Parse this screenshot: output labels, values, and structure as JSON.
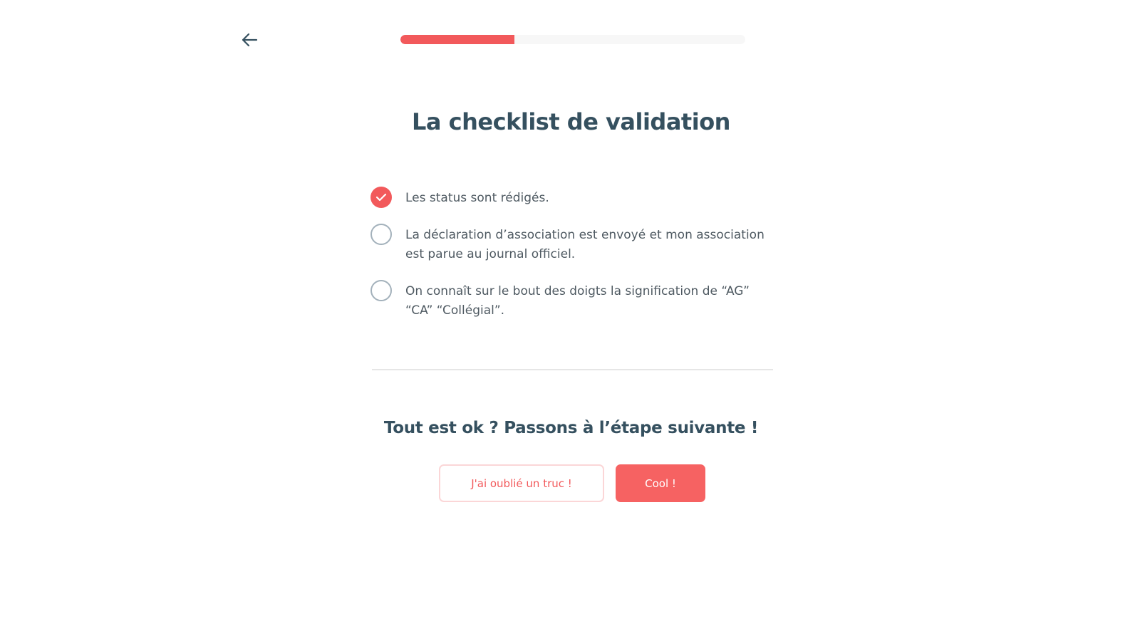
{
  "progress": {
    "value": 0.33
  },
  "title": "La checklist de validation",
  "checklist": [
    {
      "label": "Les status sont rédigés.",
      "checked": true
    },
    {
      "label": "La déclaration d’association est envoyé et mon association est parue au journal officiel.",
      "checked": false
    },
    {
      "label": "On connaît sur le bout des doigts la signification de “AG” “CA” “Collégial”.",
      "checked": false
    }
  ],
  "cta": {
    "title": "Tout est ok ? Passons à l’étape suivante !",
    "secondary_label": "J'ai oublié un truc !",
    "primary_label": "Cool !"
  },
  "colors": {
    "accent": "#f2595b",
    "heading": "#35505f",
    "text": "#4f5a62"
  },
  "icons": {
    "back": "arrow-left-icon",
    "check": "checkmark-icon"
  }
}
